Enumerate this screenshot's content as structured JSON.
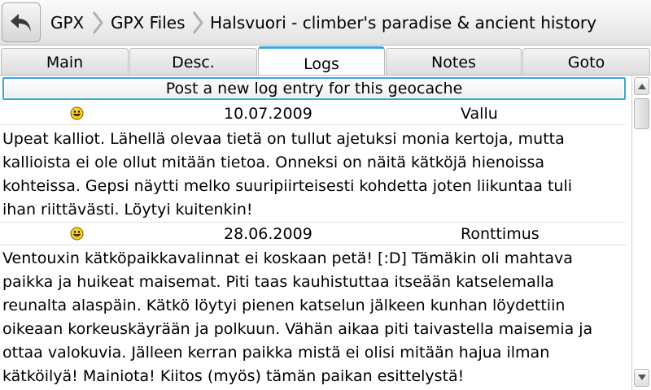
{
  "breadcrumb": {
    "items": [
      "GPX",
      "GPX Files",
      "Halsvuori - climber's paradise & ancient history"
    ]
  },
  "tabs": [
    {
      "label": "Main",
      "active": false
    },
    {
      "label": "Desc.",
      "active": false
    },
    {
      "label": "Logs",
      "active": true
    },
    {
      "label": "Notes",
      "active": false
    },
    {
      "label": "Goto",
      "active": false
    }
  ],
  "post_button_label": "Post a new log entry for this geocache",
  "logs": [
    {
      "icon": "smiley-icon",
      "date": "10.07.2009",
      "author": "Vallu",
      "lines": [
        "Upeat kalliot. Lähellä olevaa tietä on tullut ajetuksi monia kertoja, mutta",
        "kallioista ei ole ollut mitään tietoa. Onneksi on näitä kätköjä hienoissa",
        "kohteissa. Gepsi näytti melko suuripiirteisesti kohdetta joten liikuntaa tuli",
        "ihan riittävästi. Löytyi kuitenkin!"
      ]
    },
    {
      "icon": "smiley-icon",
      "date": "28.06.2009",
      "author": "Ronttimus",
      "lines": [
        "Ventouxin kätköpaikkavalinnat ei koskaan petä! [:D] Tämäkin oli mahtava",
        "paikka ja huikeat maisemat. Piti taas kauhistuttaa itseään katselemalla",
        "reunalta alaspäin. Kätkö löytyi pienen katselun jälkeen kunhan löydettiin",
        "oikeaan korkeuskäyrään ja polkuun. Vähän aikaa piti taivastella maisemia ja",
        "ottaa valokuvia. Jälleen kerran paikka mistä ei olisi mitään hajua ilman",
        "kätköilyä! Mainiota! Kiitos (myös) tämän paikan esittelystä!"
      ]
    }
  ],
  "colors": {
    "accent": "#3aa7de",
    "smiley": "#f7d21e"
  }
}
